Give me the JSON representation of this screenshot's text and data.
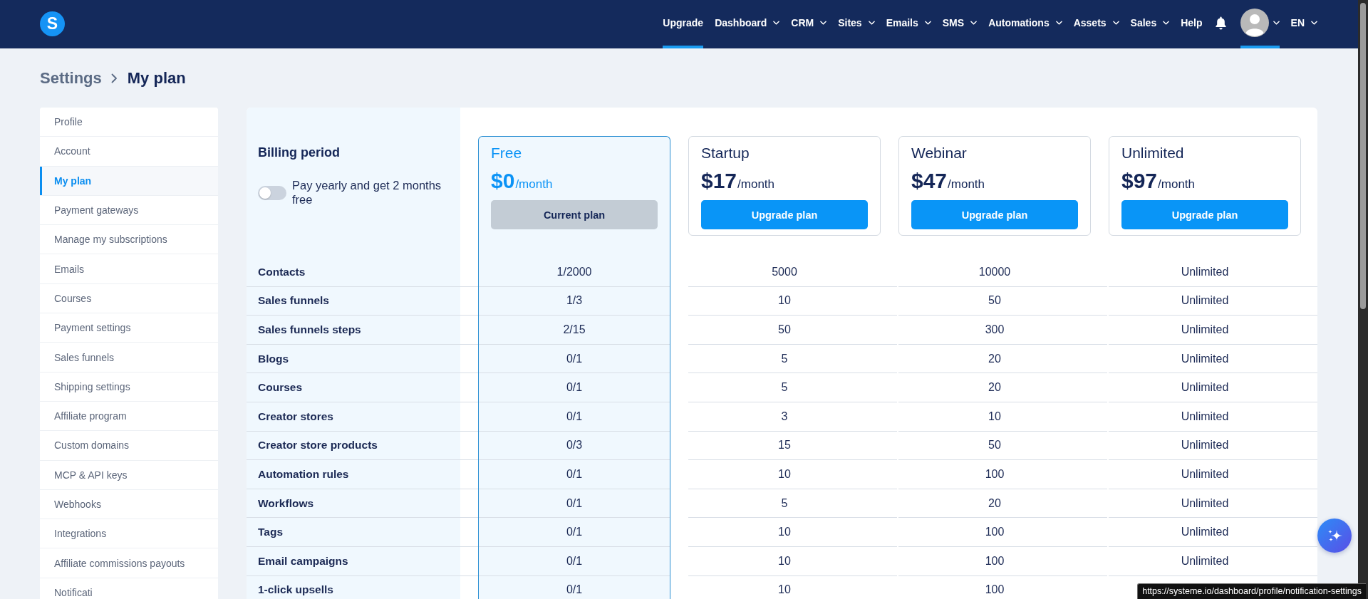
{
  "logo_text": "S",
  "nav": {
    "items": [
      {
        "label": "Upgrade",
        "dropdown": false,
        "selected": true
      },
      {
        "label": "Dashboard",
        "dropdown": true,
        "selected": false
      },
      {
        "label": "CRM",
        "dropdown": true,
        "selected": false
      },
      {
        "label": "Sites",
        "dropdown": true,
        "selected": false
      },
      {
        "label": "Emails",
        "dropdown": true,
        "selected": false
      },
      {
        "label": "SMS",
        "dropdown": true,
        "selected": false
      },
      {
        "label": "Automations",
        "dropdown": true,
        "selected": false
      },
      {
        "label": "Assets",
        "dropdown": true,
        "selected": false
      },
      {
        "label": "Sales",
        "dropdown": true,
        "selected": false
      },
      {
        "label": "Help",
        "dropdown": false,
        "selected": false
      }
    ],
    "account_menu": {
      "selected": true
    },
    "language": "EN"
  },
  "breadcrumb": {
    "parent": "Settings",
    "current": "My plan"
  },
  "sidebar": {
    "items": [
      {
        "label": "Profile",
        "selected": false
      },
      {
        "label": "Account",
        "selected": false
      },
      {
        "label": "My plan",
        "selected": true
      },
      {
        "label": "Payment gateways",
        "selected": false
      },
      {
        "label": "Manage my subscriptions",
        "selected": false
      },
      {
        "label": "Emails",
        "selected": false
      },
      {
        "label": "Courses",
        "selected": false
      },
      {
        "label": "Payment settings",
        "selected": false
      },
      {
        "label": "Sales funnels",
        "selected": false
      },
      {
        "label": "Shipping settings",
        "selected": false
      },
      {
        "label": "Affiliate program",
        "selected": false
      },
      {
        "label": "Custom domains",
        "selected": false
      },
      {
        "label": "MCP & API keys",
        "selected": false
      },
      {
        "label": "Webhooks",
        "selected": false
      },
      {
        "label": "Integrations",
        "selected": false
      },
      {
        "label": "Affiliate commissions payouts",
        "selected": false
      },
      {
        "label": "Notificati",
        "selected": false
      }
    ]
  },
  "billing": {
    "title": "Billing period",
    "toggle_label": "Pay yearly and get 2 months free",
    "yearly": false
  },
  "plans": [
    {
      "name": "Free",
      "price": "$0",
      "period": "/month",
      "current": true,
      "button": "Current plan"
    },
    {
      "name": "Startup",
      "price": "$17",
      "period": "/month",
      "current": false,
      "button": "Upgrade plan"
    },
    {
      "name": "Webinar",
      "price": "$47",
      "period": "/month",
      "current": false,
      "button": "Upgrade plan"
    },
    {
      "name": "Unlimited",
      "price": "$97",
      "period": "/month",
      "current": false,
      "button": "Upgrade plan"
    }
  ],
  "features": [
    {
      "name": "Contacts",
      "values": [
        "1/2000",
        "5000",
        "10000",
        "Unlimited"
      ]
    },
    {
      "name": "Sales funnels",
      "values": [
        "1/3",
        "10",
        "50",
        "Unlimited"
      ]
    },
    {
      "name": "Sales funnels steps",
      "values": [
        "2/15",
        "50",
        "300",
        "Unlimited"
      ]
    },
    {
      "name": "Blogs",
      "values": [
        "0/1",
        "5",
        "20",
        "Unlimited"
      ]
    },
    {
      "name": "Courses",
      "values": [
        "0/1",
        "5",
        "20",
        "Unlimited"
      ]
    },
    {
      "name": "Creator stores",
      "values": [
        "0/1",
        "3",
        "10",
        "Unlimited"
      ]
    },
    {
      "name": "Creator store products",
      "values": [
        "0/3",
        "15",
        "50",
        "Unlimited"
      ]
    },
    {
      "name": "Automation rules",
      "values": [
        "0/1",
        "10",
        "100",
        "Unlimited"
      ]
    },
    {
      "name": "Workflows",
      "values": [
        "0/1",
        "5",
        "20",
        "Unlimited"
      ]
    },
    {
      "name": "Tags",
      "values": [
        "0/1",
        "10",
        "100",
        "Unlimited"
      ]
    },
    {
      "name": "Email campaigns",
      "values": [
        "0/1",
        "10",
        "100",
        "Unlimited"
      ]
    },
    {
      "name": "1-click upsells",
      "values": [
        "0/1",
        "10",
        "100"
      ]
    }
  ],
  "status_tooltip": "https://systeme.io/dashboard/profile/notification-settings"
}
